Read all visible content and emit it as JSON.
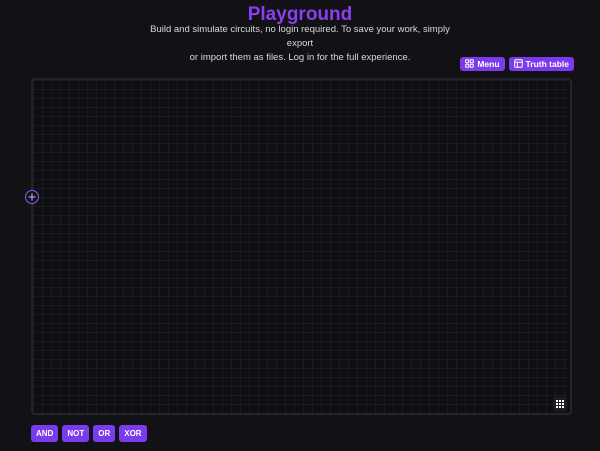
{
  "header": {
    "title": "Playground",
    "subtitle_line1": "Build and simulate circuits, no login required. To save your work, simply export",
    "subtitle_line2": "or import them as files. Log in for the full experience."
  },
  "toolbar": {
    "menu_label": "Menu",
    "truth_table_label": "Truth table",
    "menu_icon": "grid-2x2-icon",
    "truth_table_icon": "table-icon"
  },
  "canvas": {
    "add_icon": "plus-circle-icon",
    "grid_icon": "grid-3x3-icon"
  },
  "gates": [
    {
      "label": "AND"
    },
    {
      "label": "NOT"
    },
    {
      "label": "OR"
    },
    {
      "label": "XOR"
    }
  ],
  "colors": {
    "accent": "#7c3aed",
    "title": "#8b3ff0",
    "background": "#111116",
    "canvas": "#0e0f13"
  }
}
